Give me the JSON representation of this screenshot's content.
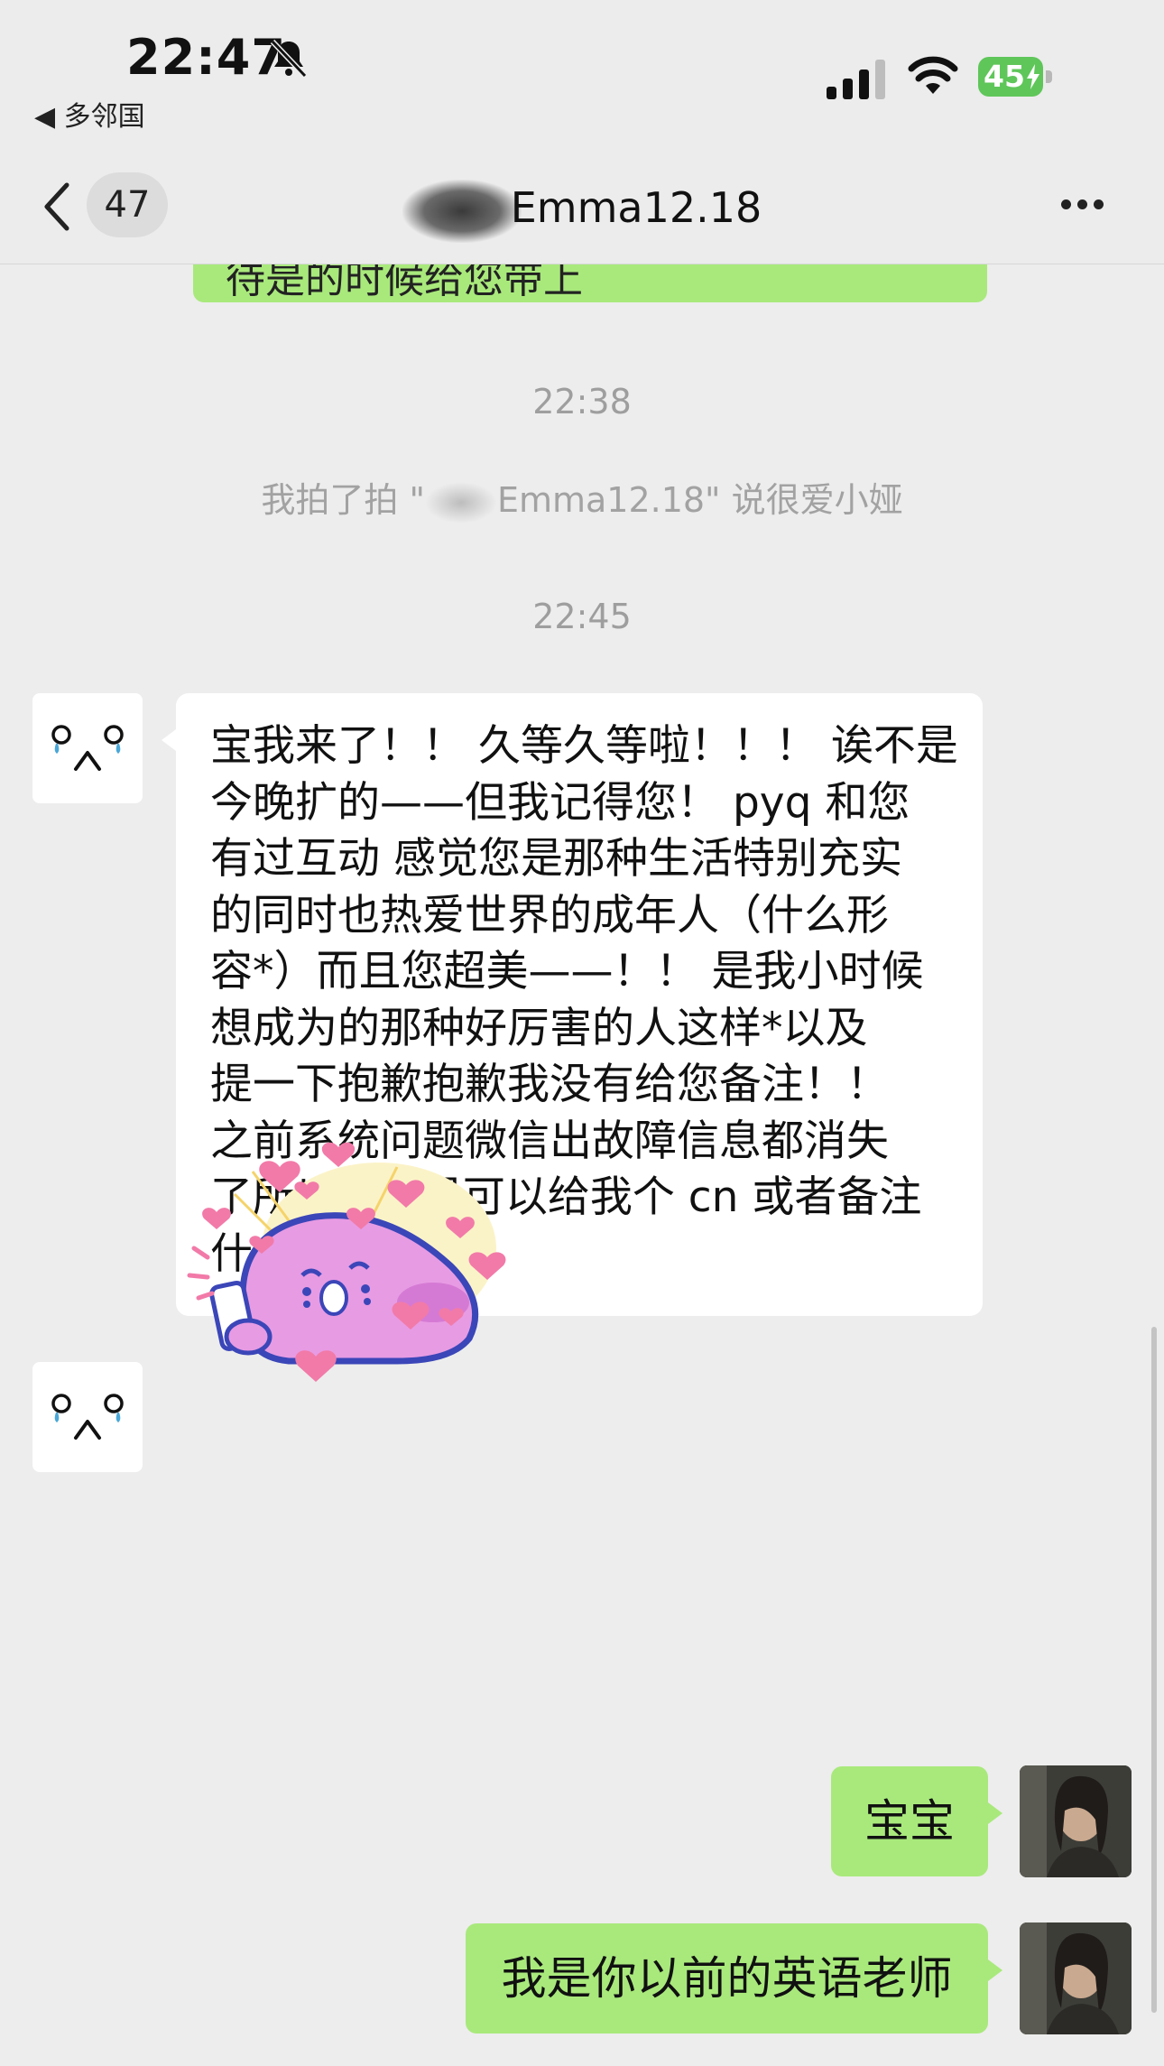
{
  "status_bar": {
    "time": "22:47",
    "back_app_label": "◀ 多邻国",
    "battery_level": "45"
  },
  "nav": {
    "unread_count": "47",
    "title": "Emma12.18",
    "more_icon": "ellipsis-icon"
  },
  "messages": {
    "previous_bubble_partial": "待是的时候给您带上",
    "timestamp_1": "22:38",
    "system_prefix": "我拍了拍 \"",
    "system_suffix": "Emma12.18\" 说很爱小娅",
    "timestamp_2": "22:45",
    "long_message_lines": [
      "宝我来了！！ 久等久等啦！！！ 诶不是",
      "今晚扩的——但我记得您！ pyq 和您",
      "有过互动 感觉您是那种生活特别充实",
      "的同时也热爱世界的成年人（什么形",
      "容*）而且您超美——！！ 是我小时候",
      "想成为的那种好厉害的人这样*以及",
      "提一下抱歉抱歉我没有给您备注！！",
      "之前系统问题微信出故障信息都消失",
      "了所以...如果可以给我个 cn 或者备注",
      "什么的啦！！"
    ],
    "reply_1": "宝宝",
    "reply_2": "我是你以前的英语老师"
  },
  "colors": {
    "background": "#ededed",
    "sent_bubble": "#a9e97c",
    "received_bubble": "#ffffff",
    "timestamp_text": "#9e9e9e",
    "battery_green": "#5fc65a"
  }
}
